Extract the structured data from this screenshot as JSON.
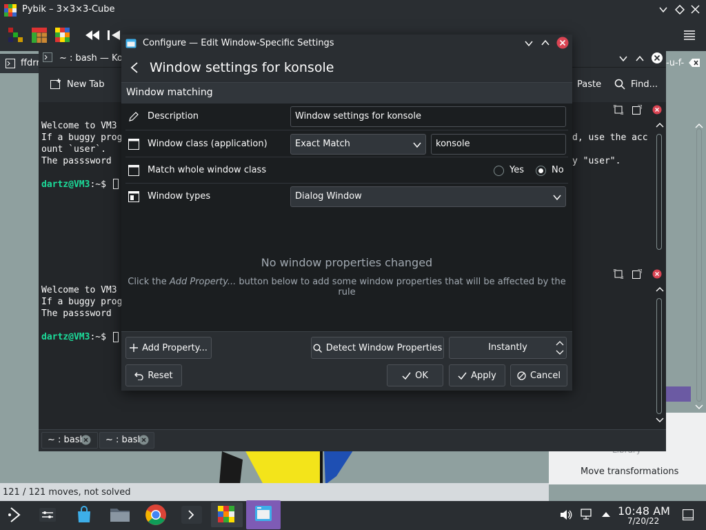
{
  "pybik": {
    "title": "Pybik – 3×3×3-Cube",
    "status": "121 / 121 moves, not solved",
    "side_items": [
      "Library",
      "Move transformations"
    ]
  },
  "outer_tab": {
    "label": "ffdrr"
  },
  "konsole": {
    "title": "~ : bash — Kon",
    "toolbar": {
      "new_tab": "New Tab",
      "paste": "Paste",
      "find": "Find..."
    },
    "pane1_lines": [
      "Welcome to VM3",
      "If a buggy prog",
      "ount `user`.",
      "The passsword "
    ],
    "pane1_right": [
      "d, use the acc",
      "y \"user\"."
    ],
    "pane2_lines": [
      "Welcome to VM3",
      "If a buggy prog",
      "The passsword "
    ],
    "prompt": "dartz@VM3",
    "prompt_suffix": ":~$",
    "tabs": [
      "~ : bash",
      "~ : bash"
    ],
    "right_title_fragment": "-u-f-"
  },
  "dialog": {
    "title": "Configure — Edit Window-Specific Settings",
    "heading": "Window settings for konsole",
    "section": "Window matching",
    "rows": {
      "description": {
        "label": "Description",
        "value": "Window settings for konsole"
      },
      "window_class": {
        "label": "Window class (application)",
        "match": "Exact Match",
        "value": "konsole"
      },
      "whole_class": {
        "label": "Match whole window class",
        "yes": "Yes",
        "no": "No",
        "selected": "No"
      },
      "window_types": {
        "label": "Window types",
        "value": "Dialog Window"
      }
    },
    "empty_title": "No window properties changed",
    "empty_hint_pre": "Click the ",
    "empty_hint_em": "Add Property...",
    "empty_hint_post": " button below to add some window properties that will be affected by the rule",
    "buttons": {
      "add_property": "Add Property...",
      "detect": "Detect Window Properties",
      "timing": "Instantly",
      "reset": "Reset",
      "ok": "OK",
      "apply": "Apply",
      "cancel": "Cancel"
    }
  },
  "taskbar": {
    "time": "10:48 AM",
    "date": "7/20/22"
  },
  "colors": {
    "accent": "#3daee9",
    "close_red": "#da4453",
    "prompt_green": "#1cdc9a",
    "active_launcher": "#7e5bb5"
  }
}
